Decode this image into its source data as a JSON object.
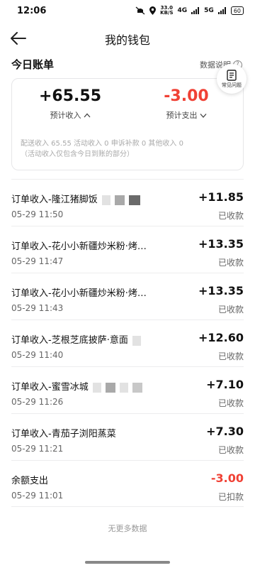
{
  "status_bar": {
    "time": "12:06",
    "speed_value": "33.0",
    "speed_unit": "KB/S",
    "network_1": "4G",
    "network_2": "5G",
    "battery": "60"
  },
  "header": {
    "title": "我的钱包"
  },
  "section": {
    "title": "今日账单",
    "data_note": "数据说明",
    "faq_label": "常见问题"
  },
  "summary": {
    "income_amount": "+65.55",
    "income_label": "预计收入",
    "expense_amount": "-3.00",
    "expense_label": "预计支出",
    "breakdown_line1": "配送收入 65.55 活动收入 0 申诉补款 0 其他收入 0",
    "breakdown_line2": "（活动收入仅包含今日到账的部分）"
  },
  "colors": {
    "negative": "#f04135",
    "text": "#111111",
    "muted": "#666666"
  },
  "transactions": [
    {
      "title": "订单收入-隆江猪脚饭",
      "time": "05-29 11:50",
      "amount": "+11.85",
      "status": "已收款"
    },
    {
      "title": "订单收入-花小小新疆炒米粉·烤…",
      "time": "05-29 11:47",
      "amount": "+13.35",
      "status": "已收款"
    },
    {
      "title": "订单收入-花小小新疆炒米粉·烤…",
      "time": "05-29 11:43",
      "amount": "+13.35",
      "status": "已收款"
    },
    {
      "title": "订单收入-芝根芝底披萨·意面",
      "time": "05-29 11:40",
      "amount": "+12.60",
      "status": "已收款"
    },
    {
      "title": "订单收入-蜜雪冰城",
      "time": "05-29 11:26",
      "amount": "+7.10",
      "status": "已收款"
    },
    {
      "title": "订单收入-青茄子浏阳蒸菜",
      "time": "05-29 11:21",
      "amount": "+7.30",
      "status": "已收款"
    },
    {
      "title": "余额支出",
      "time": "05-29 11:01",
      "amount": "-3.00",
      "status": "已扣款"
    }
  ],
  "footer": {
    "no_more": "无更多数据"
  }
}
